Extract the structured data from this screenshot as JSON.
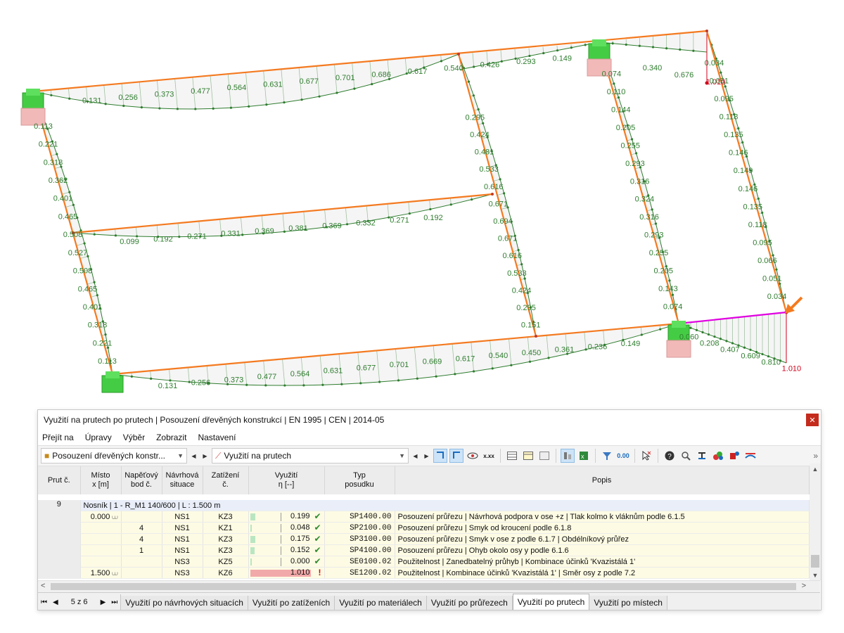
{
  "panel": {
    "title": "Využití na prutech po prutech | Posouzení dřevěných konstrukcí | EN 1995 | CEN | 2014-05",
    "menu": [
      "Přejít na",
      "Úpravy",
      "Výběr",
      "Zobrazit",
      "Nastavení"
    ],
    "toolbar": {
      "module_combo": "Posouzení dřevěných konstr...",
      "view_combo": "Využití na prutech"
    },
    "columns": {
      "member": "Prut č.",
      "location": [
        "Místo",
        "x [m]"
      ],
      "stress_point": [
        "Napěťový",
        "bod č."
      ],
      "design_situation": [
        "Návrhová",
        "situace"
      ],
      "loading": [
        "Zatížení",
        "č."
      ],
      "utilization": [
        "Využití",
        "η [--]"
      ],
      "check_type": [
        "Typ",
        "posudku"
      ],
      "description": "Popis"
    },
    "member_no": "9",
    "member_title": "Nosník | 1 - R_M1 140/600 | L : 1.500 m",
    "rows": [
      {
        "x": "0.000",
        "point": "",
        "situation": "NS1",
        "loading": "KZ3",
        "eta": "0.199",
        "eta_frac": 0.199,
        "status": "ok",
        "type": "SP1400.00",
        "desc": "Posouzení průřezu | Návrhová podpora v ose +z | Tlak kolmo k vláknům podle 6.1.5"
      },
      {
        "x": "",
        "point": "4",
        "situation": "NS1",
        "loading": "KZ1",
        "eta": "0.048",
        "eta_frac": 0.048,
        "status": "ok",
        "type": "SP2100.00",
        "desc": "Posouzení průřezu | Smyk od kroucení podle 6.1.8"
      },
      {
        "x": "",
        "point": "4",
        "situation": "NS1",
        "loading": "KZ3",
        "eta": "0.175",
        "eta_frac": 0.175,
        "status": "ok",
        "type": "SP3100.00",
        "desc": "Posouzení průřezu | Smyk v ose z podle 6.1.7 | Obdélníkový průřez"
      },
      {
        "x": "",
        "point": "1",
        "situation": "NS1",
        "loading": "KZ3",
        "eta": "0.152",
        "eta_frac": 0.152,
        "status": "ok",
        "type": "SP4100.00",
        "desc": "Posouzení průřezu | Ohyb okolo osy y podle 6.1.6"
      },
      {
        "x": "",
        "point": "",
        "situation": "NS3",
        "loading": "KZ5",
        "eta": "0.000",
        "eta_frac": 0.0,
        "status": "ok",
        "type": "SE0100.02",
        "desc": "Použitelnost | Zanedbatelný průhyb | Kombinace účinků 'Kvazistálá 1'"
      },
      {
        "x": "1.500",
        "point": "",
        "situation": "NS3",
        "loading": "KZ6",
        "eta": "1.010",
        "eta_frac": 1.01,
        "status": "fail",
        "type": "SE1200.02",
        "desc": "Použitelnost | Kombinace účinků 'Kvazistálá 1' | Směr osy z podle 7.2"
      }
    ],
    "pager": "5 z 6",
    "tabs": [
      "Využití po návrhových situacích",
      "Využití po zatíženích",
      "Využití po materiálech",
      "Využití po průřezech",
      "Využití po prutech",
      "Využití po místech"
    ],
    "active_tab": "Využití po prutech"
  },
  "labels": {
    "top_beam": [
      "0.131",
      "0.256",
      "0.373",
      "0.477",
      "0.564",
      "0.631",
      "0.677",
      "0.701",
      "0.686",
      "0.617",
      "0.540",
      "0.426",
      "0.293",
      "0.149"
    ],
    "top_right": [
      "0.340",
      "0.676",
      "1.010"
    ],
    "mid_beam": [
      "0.099",
      "0.192",
      "0.271",
      "0.331",
      "0.369",
      "0.381",
      "0.369",
      "0.332",
      "0.271",
      "0.192"
    ],
    "bottom_beam": [
      "0.131",
      "0.256",
      "0.373",
      "0.477",
      "0.564",
      "0.631",
      "0.677",
      "0.701",
      "0.669",
      "0.617",
      "0.540",
      "0.450",
      "0.361",
      "0.236",
      "0.149"
    ],
    "bottom_right": [
      "0.060",
      "0.208",
      "0.407",
      "0.609",
      "0.810",
      "1.010"
    ],
    "left_col": [
      "0.113",
      "0.221",
      "0.318",
      "0.362",
      "0.401",
      "0.465",
      "0.508",
      "0.527",
      "0.508",
      "0.465",
      "0.401",
      "0.318",
      "0.221",
      "0.113"
    ],
    "col2": [
      "0.295",
      "0.424",
      "0.481",
      "0.533",
      "0.616",
      "0.671",
      "0.694",
      "0.671",
      "0.616",
      "0.533",
      "0.424",
      "0.295",
      "0.151"
    ],
    "col3": [
      "0.074",
      "0.110",
      "0.144",
      "0.205",
      "0.255",
      "0.293",
      "0.316",
      "0.324",
      "0.316",
      "0.293",
      "0.255",
      "0.205",
      "0.143",
      "0.074"
    ],
    "col4": [
      "0.034",
      "0.051",
      "0.095",
      "0.118",
      "0.135",
      "0.146",
      "0.149",
      "0.146",
      "0.135",
      "0.118",
      "0.095",
      "0.066",
      "0.051",
      "0.034"
    ]
  },
  "colors": {
    "member": "#f47a20",
    "diagram": "#2f7d2f",
    "critical": "#d0021b",
    "highlight_member": "#e100e1",
    "support": "#3fce3f"
  }
}
